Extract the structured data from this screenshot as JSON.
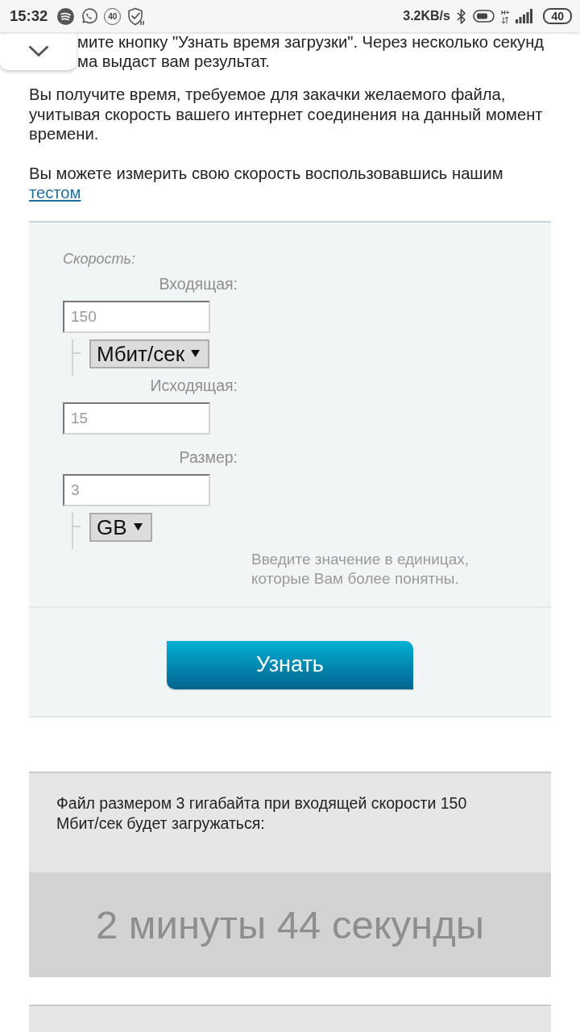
{
  "status_bar": {
    "time": "15:32",
    "notification_count": "40",
    "network_speed": "3.2KB/s",
    "network_type": "H+",
    "battery": "40"
  },
  "intro": {
    "cut_lines": [
      "мите кнопку \"Узнать время загрузки\". Через несколько секунд",
      "ма выдаст вам результат."
    ],
    "paragraphs": [
      {
        "text": "Вы получите время, требуемое для закачки желаемого файла, учитывая скорость вашего интернет соединения на данный момент времени."
      },
      {
        "text": "Вы можете измерить свою скорость воспользовавшись нашим",
        "link": "тестом"
      }
    ]
  },
  "calculator": {
    "section_label": "Скорость:",
    "fields": [
      {
        "label": "Входящая:",
        "value": "150",
        "unit": "Мбит/сек"
      },
      {
        "label": "Исходящая:",
        "value": "15"
      },
      {
        "label": "Размер:",
        "value": "3",
        "unit": "GB"
      }
    ],
    "hint": "Введите значение в единицах, которые Вам более понятны.",
    "submit": "Узнать"
  },
  "results": [
    {
      "summary": "Файл размером 3 гигабайта при входящей скорости 150 Мбит/сек будет загружаться:",
      "duration": "2 минуты 44 секунды"
    }
  ]
}
